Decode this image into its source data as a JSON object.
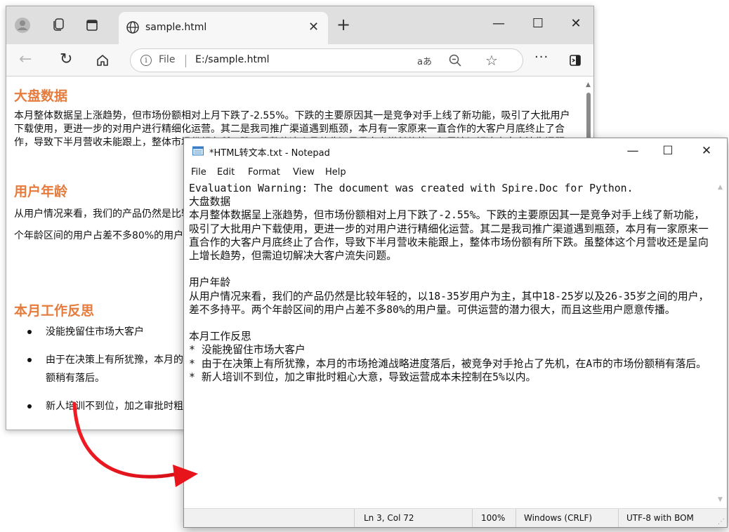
{
  "browser": {
    "tab_title": "sample.html",
    "address_scheme": "File",
    "address_url": "E:/sample.html",
    "read_aloud": "aあ",
    "more": "···"
  },
  "page": {
    "h1": "大盘数据",
    "p1": "本月整体数据呈上涨趋势，但市场份额相对上月下跌了-2.55%。下跌的主要原因其一是竞争对手上线了新功能，吸引了大批用户下载使用，更进一步的对用户进行精细化运营。其二是我司推广渠道遇到瓶颈，本月有一家原来一直合作的大客户月底终止了合作，导致下半月营收未能跟上，整体市场份额有所下跌。虽整体这个月营收还是呈向上增长趋势，但需迫切解决大客户流失问题。",
    "h2": "用户年龄",
    "p2": "从用户情况来看，我们的产品仍然是比较年轻的，以18-35岁用户为主，其中18-25岁以及26-35岁之间的用户，差不多持平。两个年龄区间的用户占差不多80%的用户量。可供运营的潜力很大，而且这些用户愿意传播。",
    "h3": "本月工作反思",
    "li1": "没能挽留住市场大客户",
    "li2a": "由于在决策上有所犹豫，本月的市场抢滩战略进度落后，被竞争对手抢占了先机，在A市的市场份",
    "li2b": "额稍有落后。",
    "li3": "新人培训不到位，加之审批时粗心大意，导致运营成本未控制在5%以内。"
  },
  "notepad": {
    "title": "*HTML转文本.txt - Notepad",
    "menu": [
      "File",
      "Edit",
      "Format",
      "View",
      "Help"
    ],
    "text": "Evaluation Warning: The document was created with Spire.Doc for Python.\n大盘数据\n本月整体数据呈上涨趋势，但市场份额相对上月下跌了-2.55%。下跌的主要原因其一是竞争对手上线了新功能，吸引了大批用户下载使用，更进一步的对用户进行精细化运营。其二是我司推广渠道遇到瓶颈，本月有一家原来一直合作的大客户月底终止了合作，导致下半月营收未能跟上，整体市场份额有所下跌。虽整体这个月营收还是呈向上增长趋势，但需迫切解决大客户流失问题。\n\n用户年龄\n从用户情况来看，我们的产品仍然是比较年轻的，以18-35岁用户为主，其中18-25岁以及26-35岁之间的用户，差不多持平。两个年龄区间的用户占差不多80%的用户量。可供运营的潜力很大，而且这些用户愿意传播。\n\n本月工作反思\n* 没能挽留住市场大客户\n* 由于在决策上有所犹豫，本月的市场抢滩战略进度落后，被竞争对手抢占了先机，在A市的市场份额稍有落后。\n* 新人培训不到位，加之审批时粗心大意，导致运营成本未控制在5%以内。",
    "status": {
      "position": "Ln 3, Col 72",
      "zoom": "100%",
      "line_ending": "Windows (CRLF)",
      "encoding": "UTF-8 with BOM"
    }
  },
  "colors": {
    "heading": "#e57b3c",
    "arrow": "#e8141b"
  }
}
